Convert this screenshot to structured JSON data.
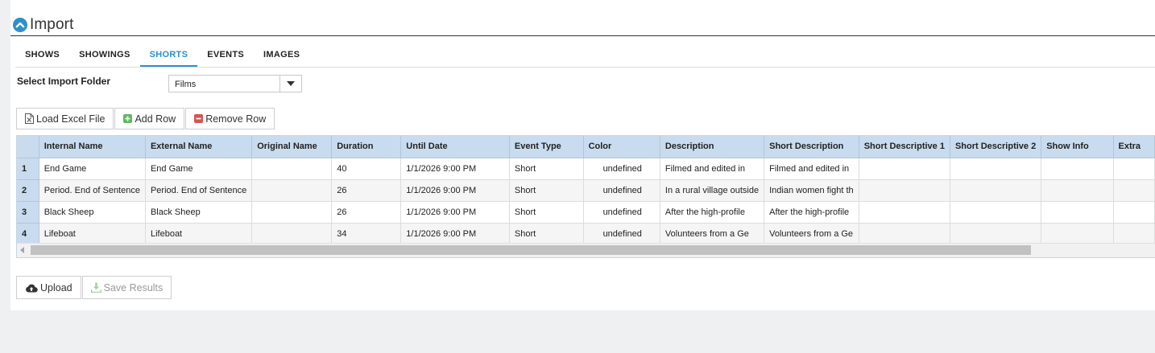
{
  "page": {
    "title": "Import"
  },
  "tabs": [
    {
      "label": "SHOWS",
      "active": false
    },
    {
      "label": "SHOWINGS",
      "active": false
    },
    {
      "label": "SHORTS",
      "active": true
    },
    {
      "label": "EVENTS",
      "active": false
    },
    {
      "label": "IMAGES",
      "active": false
    }
  ],
  "folder": {
    "label": "Select Import Folder",
    "value": "Films"
  },
  "toolbar": {
    "load_excel": "Load Excel File",
    "add_row": "Add Row",
    "remove_row": "Remove Row"
  },
  "table": {
    "columns": [
      "",
      "Internal Name",
      "External Name",
      "Original Name",
      "Duration",
      "Until Date",
      "Event Type",
      "Color",
      "Description",
      "Short Description",
      "Short Descriptive 1",
      "Short Descriptive 2",
      "Show Info",
      "Extra"
    ],
    "rows": [
      [
        "1",
        "End Game",
        "End Game",
        "",
        "40",
        "1/1/2026 9:00 PM",
        "Short",
        "undefined",
        "Filmed and edited in",
        "Filmed and edited in",
        "",
        "",
        "",
        ""
      ],
      [
        "2",
        "Period. End of Sentence",
        "Period. End of Sentence",
        "",
        "26",
        "1/1/2026 9:00 PM",
        "Short",
        "undefined",
        "In a rural village outside",
        "Indian women fight th",
        "",
        "",
        "",
        ""
      ],
      [
        "3",
        "Black Sheep",
        "Black Sheep",
        "",
        "26",
        "1/1/2026 9:00 PM",
        "Short",
        "undefined",
        "After the high-profile",
        "After the high-profile",
        "",
        "",
        "",
        ""
      ],
      [
        "4",
        "Lifeboat",
        "Lifeboat",
        "",
        "34",
        "1/1/2026 9:00 PM",
        "Short",
        "undefined",
        "Volunteers from a Ge",
        "Volunteers from a Ge",
        "",
        "",
        "",
        ""
      ]
    ]
  },
  "actions": {
    "upload": "Upload",
    "save_results": "Save Results"
  },
  "colors": {
    "accent": "#2f8fc9",
    "header_bg": "#c9dcef",
    "add_green": "#5cb85c",
    "remove_red": "#d9534f"
  },
  "icons": {
    "collapse": "chevron-up-circle-icon",
    "load_excel": "excel-file-icon",
    "add_row": "plus-square-icon",
    "remove_row": "minus-square-icon",
    "upload": "cloud-upload-icon",
    "save_results": "download-icon",
    "dropdown": "caret-down-icon"
  }
}
